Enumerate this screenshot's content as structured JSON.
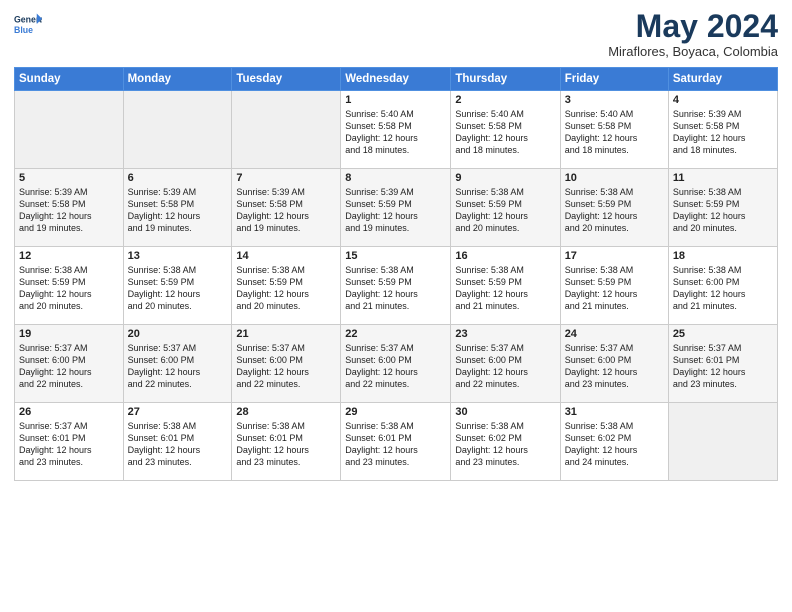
{
  "header": {
    "title": "May 2024",
    "subtitle": "Miraflores, Boyaca, Colombia"
  },
  "days": [
    "Sunday",
    "Monday",
    "Tuesday",
    "Wednesday",
    "Thursday",
    "Friday",
    "Saturday"
  ],
  "weeks": [
    [
      {
        "day": "",
        "info": ""
      },
      {
        "day": "",
        "info": ""
      },
      {
        "day": "",
        "info": ""
      },
      {
        "day": "1",
        "info": "Sunrise: 5:40 AM\nSunset: 5:58 PM\nDaylight: 12 hours\nand 18 minutes."
      },
      {
        "day": "2",
        "info": "Sunrise: 5:40 AM\nSunset: 5:58 PM\nDaylight: 12 hours\nand 18 minutes."
      },
      {
        "day": "3",
        "info": "Sunrise: 5:40 AM\nSunset: 5:58 PM\nDaylight: 12 hours\nand 18 minutes."
      },
      {
        "day": "4",
        "info": "Sunrise: 5:39 AM\nSunset: 5:58 PM\nDaylight: 12 hours\nand 18 minutes."
      }
    ],
    [
      {
        "day": "5",
        "info": "Sunrise: 5:39 AM\nSunset: 5:58 PM\nDaylight: 12 hours\nand 19 minutes."
      },
      {
        "day": "6",
        "info": "Sunrise: 5:39 AM\nSunset: 5:58 PM\nDaylight: 12 hours\nand 19 minutes."
      },
      {
        "day": "7",
        "info": "Sunrise: 5:39 AM\nSunset: 5:58 PM\nDaylight: 12 hours\nand 19 minutes."
      },
      {
        "day": "8",
        "info": "Sunrise: 5:39 AM\nSunset: 5:59 PM\nDaylight: 12 hours\nand 19 minutes."
      },
      {
        "day": "9",
        "info": "Sunrise: 5:38 AM\nSunset: 5:59 PM\nDaylight: 12 hours\nand 20 minutes."
      },
      {
        "day": "10",
        "info": "Sunrise: 5:38 AM\nSunset: 5:59 PM\nDaylight: 12 hours\nand 20 minutes."
      },
      {
        "day": "11",
        "info": "Sunrise: 5:38 AM\nSunset: 5:59 PM\nDaylight: 12 hours\nand 20 minutes."
      }
    ],
    [
      {
        "day": "12",
        "info": "Sunrise: 5:38 AM\nSunset: 5:59 PM\nDaylight: 12 hours\nand 20 minutes."
      },
      {
        "day": "13",
        "info": "Sunrise: 5:38 AM\nSunset: 5:59 PM\nDaylight: 12 hours\nand 20 minutes."
      },
      {
        "day": "14",
        "info": "Sunrise: 5:38 AM\nSunset: 5:59 PM\nDaylight: 12 hours\nand 20 minutes."
      },
      {
        "day": "15",
        "info": "Sunrise: 5:38 AM\nSunset: 5:59 PM\nDaylight: 12 hours\nand 21 minutes."
      },
      {
        "day": "16",
        "info": "Sunrise: 5:38 AM\nSunset: 5:59 PM\nDaylight: 12 hours\nand 21 minutes."
      },
      {
        "day": "17",
        "info": "Sunrise: 5:38 AM\nSunset: 5:59 PM\nDaylight: 12 hours\nand 21 minutes."
      },
      {
        "day": "18",
        "info": "Sunrise: 5:38 AM\nSunset: 6:00 PM\nDaylight: 12 hours\nand 21 minutes."
      }
    ],
    [
      {
        "day": "19",
        "info": "Sunrise: 5:37 AM\nSunset: 6:00 PM\nDaylight: 12 hours\nand 22 minutes."
      },
      {
        "day": "20",
        "info": "Sunrise: 5:37 AM\nSunset: 6:00 PM\nDaylight: 12 hours\nand 22 minutes."
      },
      {
        "day": "21",
        "info": "Sunrise: 5:37 AM\nSunset: 6:00 PM\nDaylight: 12 hours\nand 22 minutes."
      },
      {
        "day": "22",
        "info": "Sunrise: 5:37 AM\nSunset: 6:00 PM\nDaylight: 12 hours\nand 22 minutes."
      },
      {
        "day": "23",
        "info": "Sunrise: 5:37 AM\nSunset: 6:00 PM\nDaylight: 12 hours\nand 22 minutes."
      },
      {
        "day": "24",
        "info": "Sunrise: 5:37 AM\nSunset: 6:00 PM\nDaylight: 12 hours\nand 23 minutes."
      },
      {
        "day": "25",
        "info": "Sunrise: 5:37 AM\nSunset: 6:01 PM\nDaylight: 12 hours\nand 23 minutes."
      }
    ],
    [
      {
        "day": "26",
        "info": "Sunrise: 5:37 AM\nSunset: 6:01 PM\nDaylight: 12 hours\nand 23 minutes."
      },
      {
        "day": "27",
        "info": "Sunrise: 5:38 AM\nSunset: 6:01 PM\nDaylight: 12 hours\nand 23 minutes."
      },
      {
        "day": "28",
        "info": "Sunrise: 5:38 AM\nSunset: 6:01 PM\nDaylight: 12 hours\nand 23 minutes."
      },
      {
        "day": "29",
        "info": "Sunrise: 5:38 AM\nSunset: 6:01 PM\nDaylight: 12 hours\nand 23 minutes."
      },
      {
        "day": "30",
        "info": "Sunrise: 5:38 AM\nSunset: 6:02 PM\nDaylight: 12 hours\nand 23 minutes."
      },
      {
        "day": "31",
        "info": "Sunrise: 5:38 AM\nSunset: 6:02 PM\nDaylight: 12 hours\nand 24 minutes."
      },
      {
        "day": "",
        "info": ""
      }
    ]
  ]
}
